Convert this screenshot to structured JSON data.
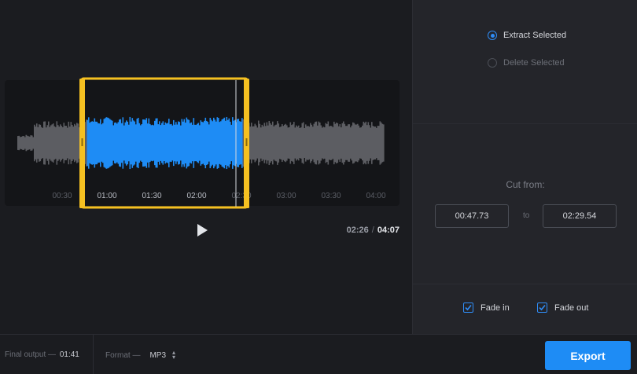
{
  "editor": {
    "timeline_labels": [
      "00:30",
      "01:00",
      "01:30",
      "02:00",
      "02:30",
      "03:00",
      "03:30",
      "04:00"
    ],
    "selection_tick_labels": [
      "01:00",
      "01:30",
      "02:00"
    ],
    "current_time": "02:26",
    "separator": "/",
    "total_time": "04:07",
    "play_icon": "play-icon",
    "colors": {
      "selected_wave": "#1e8cf5",
      "unselected_wave": "#5c5d62",
      "selection_frame": "#f5c021"
    }
  },
  "options": {
    "extract_label": "Extract Selected",
    "delete_label": "Delete Selected",
    "selected": "extract"
  },
  "cut": {
    "label": "Cut from:",
    "from": "00:47.73",
    "to_label": "to",
    "to": "02:29.54"
  },
  "fades": {
    "fade_in_label": "Fade in",
    "fade_in_checked": true,
    "fade_out_label": "Fade out",
    "fade_out_checked": true
  },
  "footer": {
    "final_output_label": "Final output",
    "final_output_value": "01:41",
    "format_label": "Format",
    "format_value": "MP3",
    "dash": "—",
    "export_label": "Export"
  }
}
